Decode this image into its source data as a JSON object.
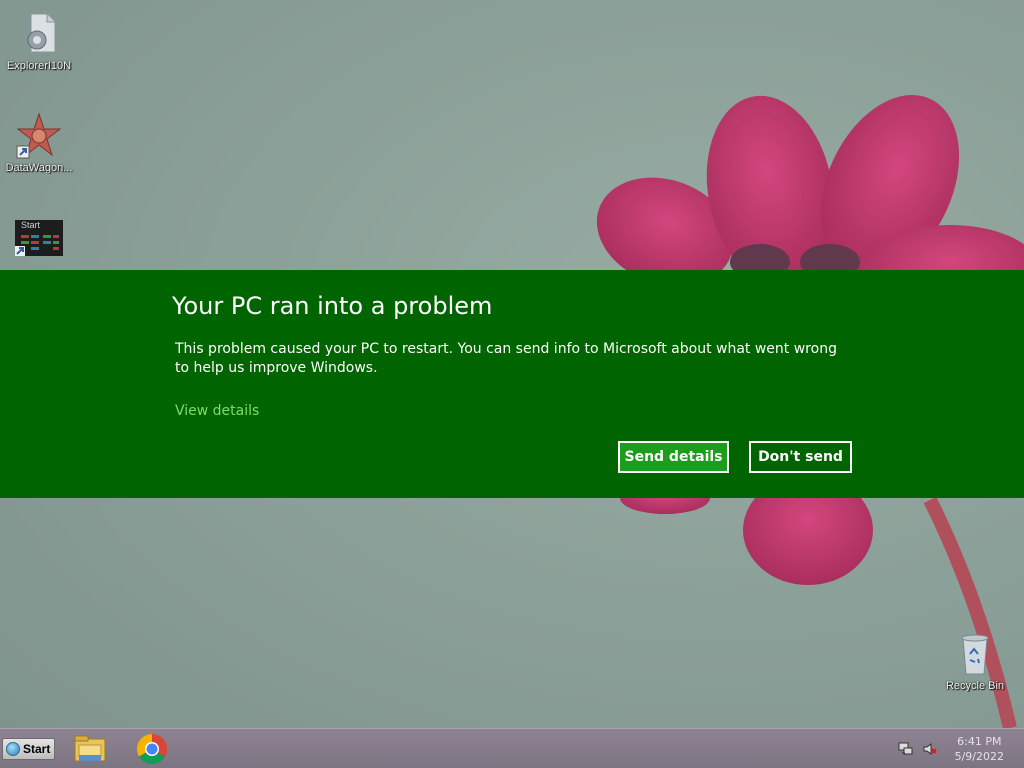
{
  "desktop": {
    "icons": [
      {
        "label": "ExplorerI10N"
      },
      {
        "label": "DataWagon..."
      },
      {
        "label": "Recycle Bin"
      }
    ],
    "start_icon_text": "Start"
  },
  "error_dialog": {
    "title": "Your PC ran into a problem",
    "message": "This problem caused your PC to restart. You can send info to Microsoft about what went wrong to help us improve Windows.",
    "view_details": "View details",
    "send_details_label": "Send details",
    "dont_send_label": "Don't send",
    "colors": {
      "background": "#006400",
      "primary_button": "#1c9d1c",
      "link": "#7ddc6b"
    }
  },
  "taskbar": {
    "start_label": "Start",
    "pinned": [
      {
        "icon": "file-explorer-icon"
      },
      {
        "icon": "chrome-icon"
      }
    ],
    "tray_icons": [
      "network-icon",
      "volume-muted-icon"
    ],
    "time": "6:41 PM",
    "date": "5/9/2022"
  }
}
